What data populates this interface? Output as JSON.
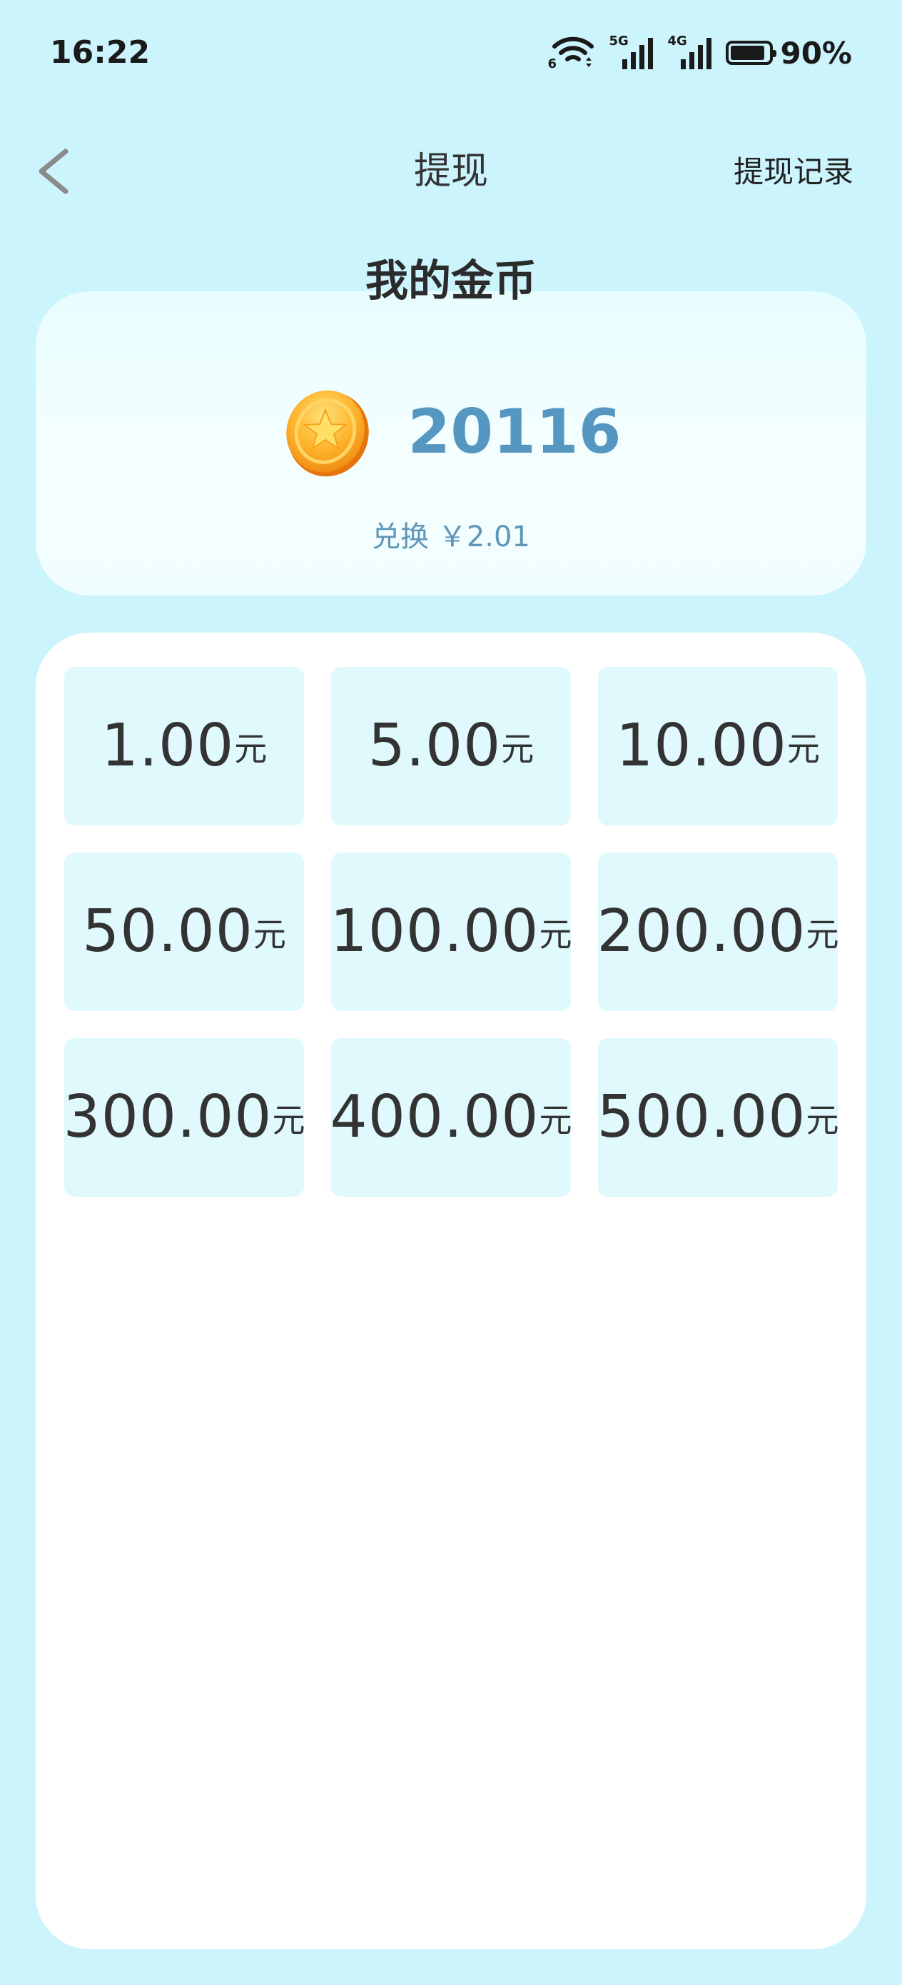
{
  "status_bar": {
    "time": "16:22",
    "wifi_tag": "6",
    "signal1_tag": "5G",
    "signal2_tag": "4G",
    "battery_percent": "90%",
    "battery_level": 0.9
  },
  "nav": {
    "back_icon": "chevron-left-icon",
    "title": "提现",
    "right_action": "提现记录"
  },
  "coins": {
    "title": "我的金币",
    "icon": "gold-coin-icon",
    "amount": "20116",
    "exchange_text": "兑换 ￥2.01"
  },
  "options": [
    {
      "value": "1.00",
      "unit": "元"
    },
    {
      "value": "5.00",
      "unit": "元"
    },
    {
      "value": "10.00",
      "unit": "元"
    },
    {
      "value": "50.00",
      "unit": "元"
    },
    {
      "value": "100.00",
      "unit": "元"
    },
    {
      "value": "200.00",
      "unit": "元"
    },
    {
      "value": "300.00",
      "unit": "元"
    },
    {
      "value": "400.00",
      "unit": "元"
    },
    {
      "value": "500.00",
      "unit": "元"
    }
  ],
  "colors": {
    "background": "#ccf4fc",
    "accent": "#5597c0",
    "option_bg": "#dff9fd"
  }
}
